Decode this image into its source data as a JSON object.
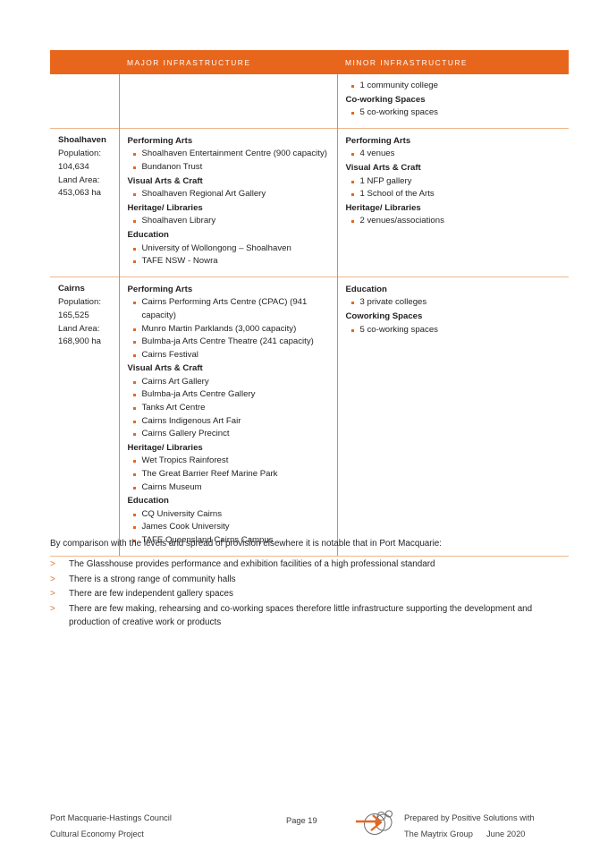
{
  "colors": {
    "header_orange": "#E8661C",
    "bullet_orange": "#E8661C",
    "row_divider": "#EFB68C",
    "column_divider": "#9D9D9D",
    "arrow_marker": "#E0732E",
    "text": "#231F20"
  },
  "table": {
    "headers": {
      "blank": "",
      "major": "MAJOR INFRASTRUCTURE",
      "minor": "MINOR INFRASTRUCTURE"
    },
    "rows": [
      {
        "lga": {
          "name": "",
          "stats": []
        },
        "major": [],
        "minor": [
          {
            "category": "",
            "items": [
              "1 community college"
            ]
          },
          {
            "category": "Co-working Spaces",
            "items": [
              "5 co-working spaces"
            ]
          }
        ]
      },
      {
        "lga": {
          "name": "Shoalhaven",
          "stats": [
            "Population:",
            "104,634",
            "Land Area:",
            "453,063 ha"
          ]
        },
        "major": [
          {
            "category": "Performing Arts",
            "items": [
              "Shoalhaven Entertainment Centre (900 capacity)",
              "Bundanon Trust"
            ]
          },
          {
            "category": "Visual Arts & Craft",
            "items": [
              "Shoalhaven Regional Art Gallery"
            ]
          },
          {
            "category": "Heritage/ Libraries",
            "items": [
              "Shoalhaven Library"
            ]
          },
          {
            "category": "Education",
            "items": [
              "University of Wollongong – Shoalhaven",
              "TAFE NSW - Nowra"
            ]
          }
        ],
        "minor": [
          {
            "category": "Performing Arts",
            "items": [
              "4 venues"
            ]
          },
          {
            "category": "Visual Arts & Craft",
            "items": [
              "1 NFP gallery",
              "1 School of the Arts"
            ]
          },
          {
            "category": "Heritage/ Libraries",
            "items": [
              "2 venues/associations"
            ]
          }
        ]
      },
      {
        "lga": {
          "name": "Cairns",
          "stats": [
            "Population:",
            "165,525",
            "Land Area:",
            "168,900 ha"
          ]
        },
        "major": [
          {
            "category": "Performing Arts",
            "items": [
              "Cairns Performing Arts Centre (CPAC) (941 capacity)",
              "Munro Martin Parklands (3,000 capacity)",
              "Bulmba-ja Arts Centre Theatre (241 capacity)",
              "Cairns Festival"
            ]
          },
          {
            "category": "Visual Arts & Craft",
            "items": [
              "Cairns Art Gallery",
              "Bulmba-ja Arts Centre Gallery",
              "Tanks Art Centre",
              "Cairns Indigenous Art Fair",
              "Cairns Gallery Precinct"
            ]
          },
          {
            "category": "Heritage/ Libraries",
            "items": [
              "Wet Tropics Rainforest",
              "The Great Barrier Reef Marine Park",
              "Cairns Museum"
            ]
          },
          {
            "category": "Education",
            "items": [
              "CQ University Cairns",
              "James Cook University",
              "TAFE Queensland Cairns Campus"
            ]
          }
        ],
        "minor": [
          {
            "category": "Education",
            "items": [
              "3 private colleges"
            ]
          },
          {
            "category": "Coworking Spaces",
            "items": [
              "5 co-working spaces"
            ]
          }
        ]
      }
    ]
  },
  "prose": {
    "lead": "By comparison with the levels and spread of provision elsewhere it is notable that in Port Macquarie:",
    "bullets": [
      "The Glasshouse provides performance and exhibition facilities of a high professional standard",
      "There is a strong range of community halls",
      "There are few independent gallery spaces",
      "There are few making, rehearsing and co-working spaces therefore little infrastructure supporting the development and production of creative work or products"
    ]
  },
  "footer": {
    "left_line1": "Port Macquarie-Hastings Council",
    "left_line2": "Cultural Economy Project",
    "page": "Page 19",
    "right_line1": "Prepared by Positive Solutions with",
    "right_line2a": "The Maytrix Group",
    "right_line2b": "June 2020",
    "logo_name": "positive-solutions-logo"
  }
}
